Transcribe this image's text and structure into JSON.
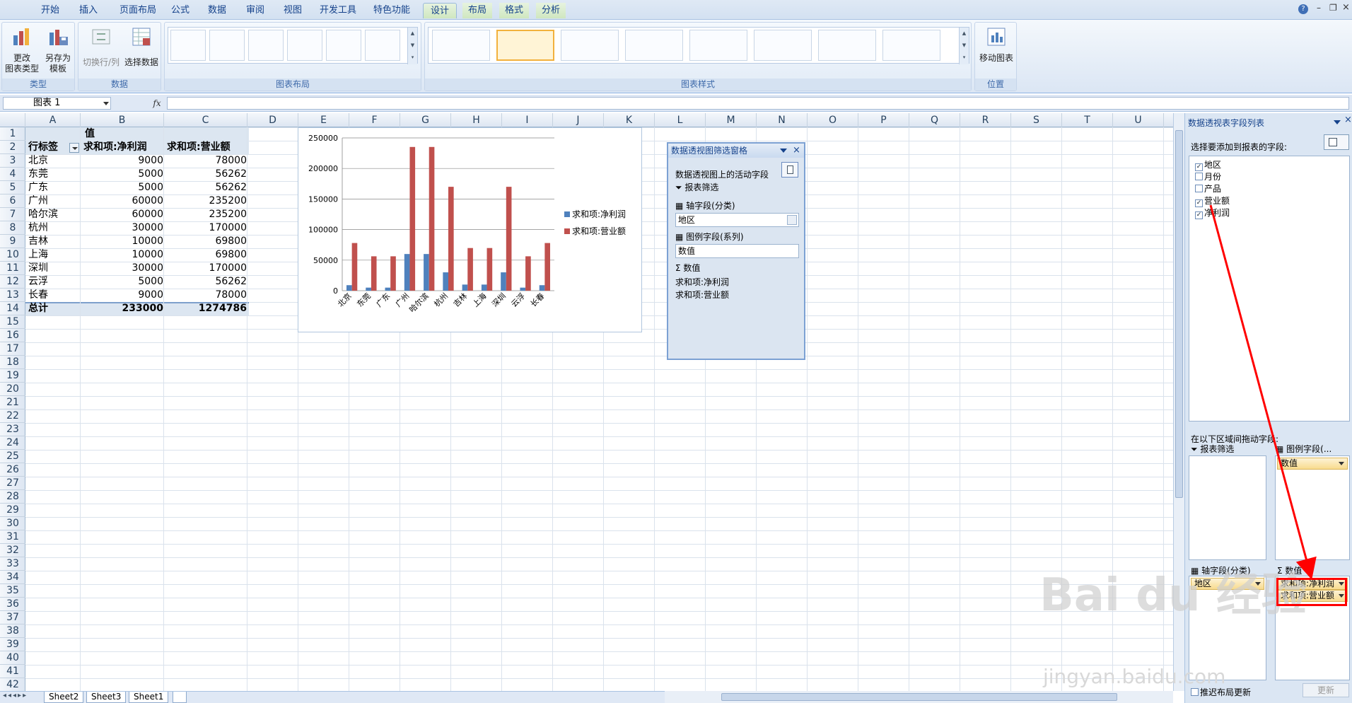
{
  "ribbon_tabs": [
    "开始",
    "插入",
    "页面布局",
    "公式",
    "数据",
    "审阅",
    "视图",
    "开发工具",
    "特色功能",
    "设计",
    "布局",
    "格式",
    "分析"
  ],
  "active_tab": "设计",
  "groups": {
    "type": {
      "label": "类型",
      "btn1": "更改\n图表类型",
      "btn2": "另存为\n模板"
    },
    "data": {
      "label": "数据",
      "btn1": "切换行/列",
      "btn2": "选择数据"
    },
    "layout": {
      "label": "图表布局"
    },
    "styles": {
      "label": "图表样式"
    },
    "location": {
      "label": "位置",
      "btn1": "移动图表"
    }
  },
  "namebox": "图表 1",
  "fx": "fx",
  "columns": [
    "A",
    "B",
    "C",
    "D",
    "E",
    "F",
    "G",
    "H",
    "I",
    "J",
    "K",
    "L",
    "M",
    "N",
    "O",
    "P",
    "Q",
    "R",
    "S",
    "T",
    "U"
  ],
  "pivot": {
    "values_header": "值",
    "row_label": "行标签",
    "col1": "求和项:净利润",
    "col2": "求和项:营业额",
    "rows": [
      {
        "city": "北京",
        "profit": "9000",
        "revenue": "78000"
      },
      {
        "city": "东莞",
        "profit": "5000",
        "revenue": "56262"
      },
      {
        "city": "广东",
        "profit": "5000",
        "revenue": "56262"
      },
      {
        "city": "广州",
        "profit": "60000",
        "revenue": "235200"
      },
      {
        "city": "哈尔滨",
        "profit": "60000",
        "revenue": "235200"
      },
      {
        "city": "杭州",
        "profit": "30000",
        "revenue": "170000"
      },
      {
        "city": "吉林",
        "profit": "10000",
        "revenue": "69800"
      },
      {
        "city": "上海",
        "profit": "10000",
        "revenue": "69800"
      },
      {
        "city": "深圳",
        "profit": "30000",
        "revenue": "170000"
      },
      {
        "city": "云浮",
        "profit": "5000",
        "revenue": "56262"
      },
      {
        "city": "长春",
        "profit": "9000",
        "revenue": "78000"
      }
    ],
    "total_label": "总计",
    "total_profit": "233000",
    "total_revenue": "1274786"
  },
  "chart_data": {
    "type": "bar",
    "categories": [
      "北京",
      "东莞",
      "广东",
      "广州",
      "哈尔滨",
      "杭州",
      "吉林",
      "上海",
      "深圳",
      "云浮",
      "长春"
    ],
    "series": [
      {
        "name": "求和项:净利润",
        "color": "#4f81bd",
        "values": [
          9000,
          5000,
          5000,
          60000,
          60000,
          30000,
          10000,
          10000,
          30000,
          5000,
          9000
        ]
      },
      {
        "name": "求和项:营业额",
        "color": "#c0504d",
        "values": [
          78000,
          56262,
          56262,
          235200,
          235200,
          170000,
          69800,
          69800,
          170000,
          56262,
          78000
        ]
      }
    ],
    "yticks": [
      "0",
      "50000",
      "100000",
      "150000",
      "200000",
      "250000"
    ],
    "ylim": [
      0,
      250000
    ],
    "grid": true,
    "legend": "right"
  },
  "filter_pane": {
    "title": "数据透视图筛选窗格",
    "active_fields": "数据透视图上的活动字段",
    "report_filter": "报表筛选",
    "axis_field": "轴字段(分类)",
    "axis_value": "地区",
    "legend_field": "图例字段(系列)",
    "legend_value": "数值",
    "values": "数值",
    "value1": "求和项:净利润",
    "value2": "求和项:营业额"
  },
  "field_list": {
    "title": "数据透视表字段列表",
    "choose": "选择要添加到报表的字段:",
    "fields": [
      {
        "name": "地区",
        "checked": true
      },
      {
        "name": "月份",
        "checked": false
      },
      {
        "name": "产品",
        "checked": false
      },
      {
        "name": "营业额",
        "checked": true
      },
      {
        "name": "净利润",
        "checked": true
      }
    ],
    "drag_label": "在以下区域间拖动字段:",
    "report_filter": "报表筛选",
    "legend_fields": "图例字段(...",
    "legend_pill": "数值",
    "axis_fields": "轴字段(分类)",
    "axis_pill": "地区",
    "values_label": "数值",
    "value_pill1": "求和项:净利润",
    "value_pill2": "求和项:营业额",
    "defer_label": "推迟布局更新",
    "update_btn": "更新"
  },
  "sheet_tabs": [
    "Sheet2",
    "Sheet3",
    "Sheet1"
  ],
  "watermark": "Bai du 经验",
  "watermark_url": "jingyan.baidu.com"
}
